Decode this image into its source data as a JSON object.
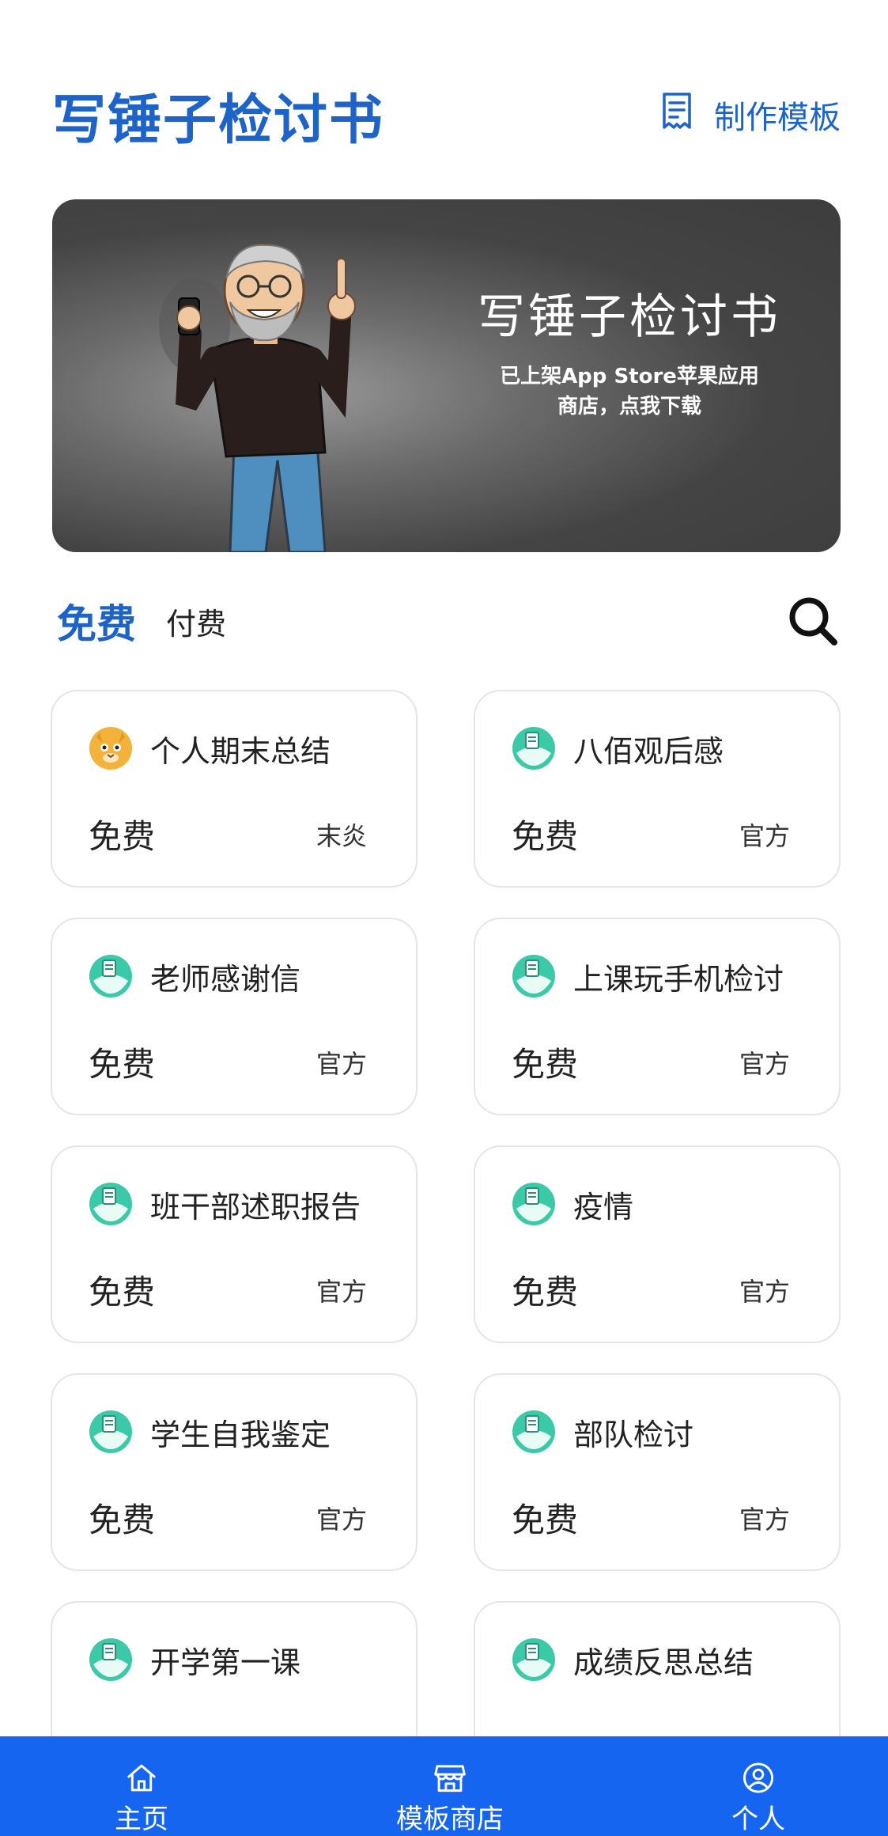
{
  "header": {
    "title": "写锤子检讨书",
    "make_template_label": "制作模板"
  },
  "banner": {
    "title": "写锤子检讨书",
    "subtitle": "已上架App Store苹果应用商店，点我下载"
  },
  "tabs": [
    {
      "label": "免费",
      "active": true
    },
    {
      "label": "付费",
      "active": false
    }
  ],
  "cards": [
    {
      "title": "个人期末总结",
      "price": "免费",
      "author": "末炎",
      "avatar": "cat-avatar"
    },
    {
      "title": "八佰观后感",
      "price": "免费",
      "author": "官方",
      "avatar": "official-avatar"
    },
    {
      "title": "老师感谢信",
      "price": "免费",
      "author": "官方",
      "avatar": "official-avatar"
    },
    {
      "title": "上课玩手机检讨",
      "price": "免费",
      "author": "官方",
      "avatar": "official-avatar"
    },
    {
      "title": "班干部述职报告",
      "price": "免费",
      "author": "官方",
      "avatar": "official-avatar"
    },
    {
      "title": "疫情",
      "price": "免费",
      "author": "官方",
      "avatar": "official-avatar"
    },
    {
      "title": "学生自我鉴定",
      "price": "免费",
      "author": "官方",
      "avatar": "official-avatar"
    },
    {
      "title": "部队检讨",
      "price": "免费",
      "author": "官方",
      "avatar": "official-avatar"
    },
    {
      "title": "开学第一课",
      "price": "",
      "author": "",
      "avatar": "official-avatar"
    },
    {
      "title": "成绩反思总结",
      "price": "",
      "author": "",
      "avatar": "official-avatar"
    }
  ],
  "bottom_nav": [
    {
      "label": "主页",
      "icon": "home-icon"
    },
    {
      "label": "模板商店",
      "icon": "store-icon"
    },
    {
      "label": "个人",
      "icon": "user-icon"
    }
  ],
  "colors": {
    "accent": "#1e63c8",
    "nav_bg": "#1565f0",
    "avatar_teal": "#3cc9a8"
  }
}
